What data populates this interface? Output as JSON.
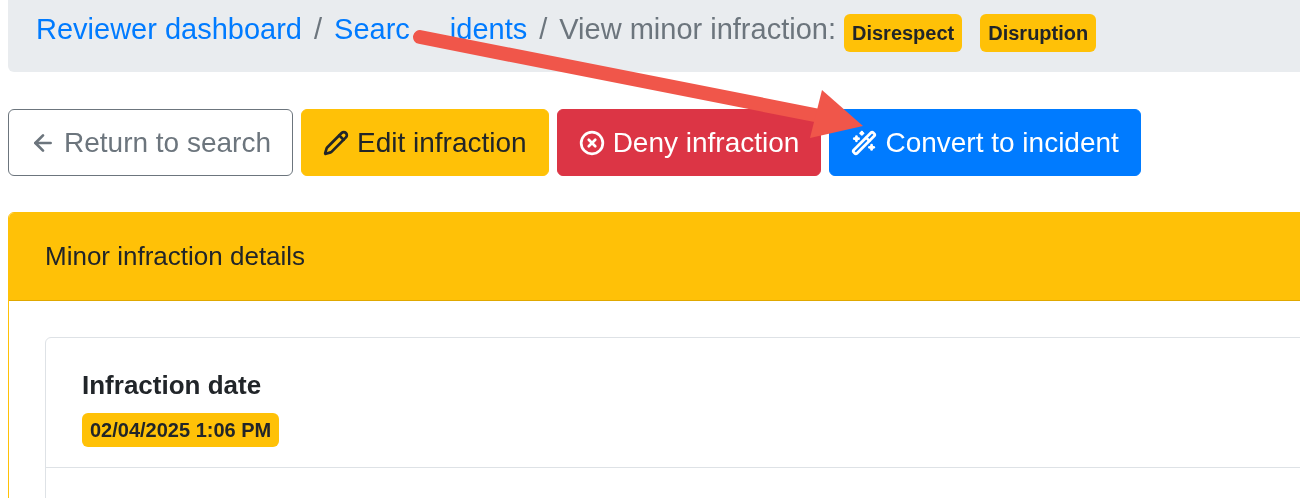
{
  "breadcrumb": {
    "items": [
      {
        "parts": [
          "Reviewer dashboard"
        ],
        "kind": "link"
      },
      {
        "parts": [
          "Searc",
          "idents"
        ],
        "kind": "link"
      },
      {
        "parts": [
          "View minor infraction:"
        ],
        "kind": "current"
      }
    ],
    "separator": "/",
    "badges": [
      "Disrespect",
      "Disruption"
    ]
  },
  "buttons": [
    {
      "label": "Return to search",
      "kind": "back"
    },
    {
      "label": "Edit infraction",
      "kind": "edit"
    },
    {
      "label": "Deny infraction",
      "kind": "deny"
    },
    {
      "label": "Convert to incident",
      "kind": "convert"
    }
  ],
  "card": {
    "header": "Minor infraction details",
    "field": {
      "label": "Infraction date",
      "value": "02/04/2025 1:06 PM"
    }
  }
}
